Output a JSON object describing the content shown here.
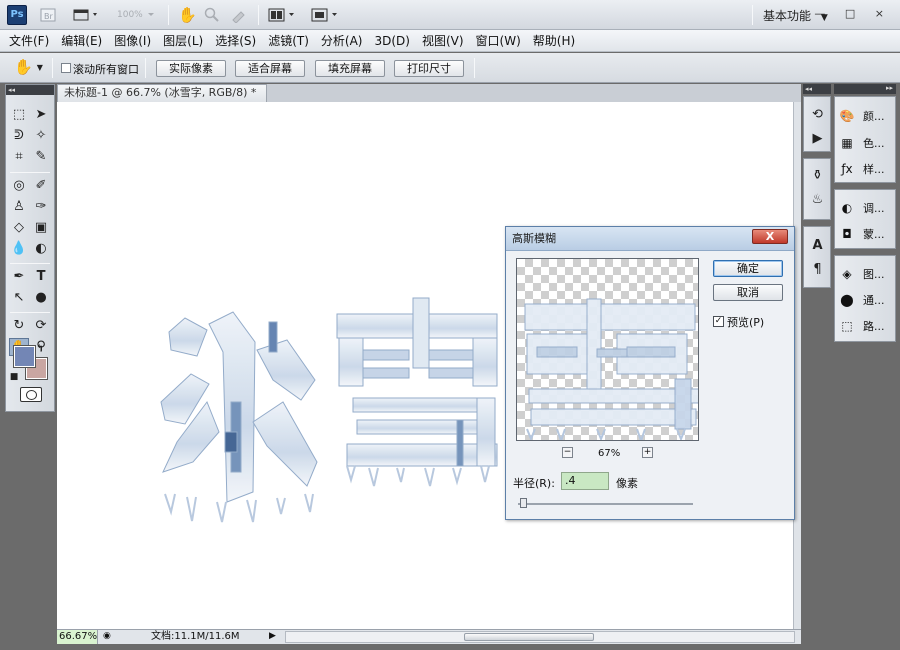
{
  "app": {
    "logo": "Ps",
    "zoom_preset": "100%",
    "workspace": "基本功能",
    "window_controls": "— □ ×"
  },
  "menu": [
    "文件(F)",
    "编辑(E)",
    "图像(I)",
    "图层(L)",
    "选择(S)",
    "滤镜(T)",
    "分析(A)",
    "3D(D)",
    "视图(V)",
    "窗口(W)",
    "帮助(H)"
  ],
  "options_bar": {
    "scroll_all_label": "滚动所有窗口",
    "btn_actual": "实际像素",
    "btn_fit": "适合屏幕",
    "btn_fill": "填充屏幕",
    "btn_print": "打印尺寸"
  },
  "document": {
    "tab_title": "未标题-1 @ 66.7% (冰雪字, RGB/8) *",
    "tab_close": "×",
    "zoom": "66.67%",
    "doc_info": "文档:11.1M/11.6M"
  },
  "toolbox": {
    "foreground": "#7386b5",
    "background": "#c9a6a2"
  },
  "panels": {
    "items": [
      "颜...",
      "色...",
      "样...",
      "调...",
      "蒙...",
      "图...",
      "通...",
      "路..."
    ]
  },
  "dialog": {
    "title": "高斯模糊",
    "close": "X",
    "ok": "确定",
    "cancel": "取消",
    "preview_label": "预览(P)",
    "preview_checked": "✓",
    "zoom_out": "−",
    "zoom_in": "+",
    "zoom_pct": "67%",
    "radius_label": "半径(R):",
    "radius_value": ".4",
    "radius_unit": "像素"
  },
  "colors": {
    "accent": "#2f6fb0",
    "ice_light": "#dfe8f2",
    "ice_dark": "#4f6f9a"
  }
}
